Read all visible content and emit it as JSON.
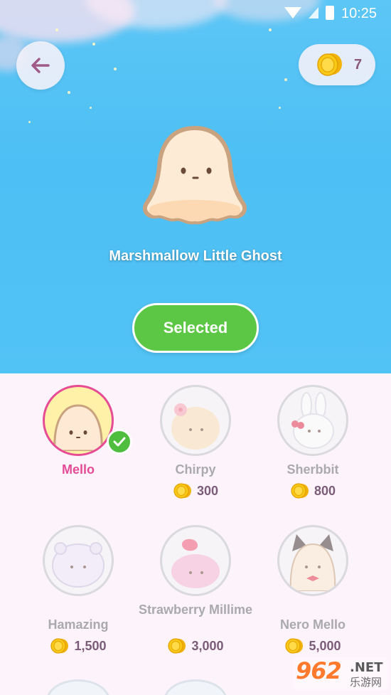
{
  "status_bar": {
    "time": "10:25"
  },
  "header": {
    "coin_balance": "7"
  },
  "hero": {
    "character_name": "Marshmallow Little Ghost",
    "selected_button_label": "Selected"
  },
  "characters": [
    {
      "name": "Mello",
      "price": "",
      "selected": true
    },
    {
      "name": "Chirpy",
      "price": "300",
      "selected": false
    },
    {
      "name": "Sherbbit",
      "price": "800",
      "selected": false
    },
    {
      "name": "Hamazing",
      "price": "1,500",
      "selected": false
    },
    {
      "name": "Strawberry Millime",
      "price": "3,000",
      "selected": false
    },
    {
      "name": "Nero Mello",
      "price": "5,000",
      "selected": false
    }
  ],
  "watermark": {
    "logo": "962",
    "domain": ".NET",
    "caption": "乐游网"
  },
  "colors": {
    "sky": "#4dbff4",
    "selected_green": "#5cc744",
    "selected_pink": "#e44b96",
    "grid_bg": "#fdf3fb"
  },
  "icons": [
    "back-arrow-icon",
    "coin-icon",
    "check-icon",
    "wifi-icon",
    "signal-icon",
    "battery-icon"
  ]
}
